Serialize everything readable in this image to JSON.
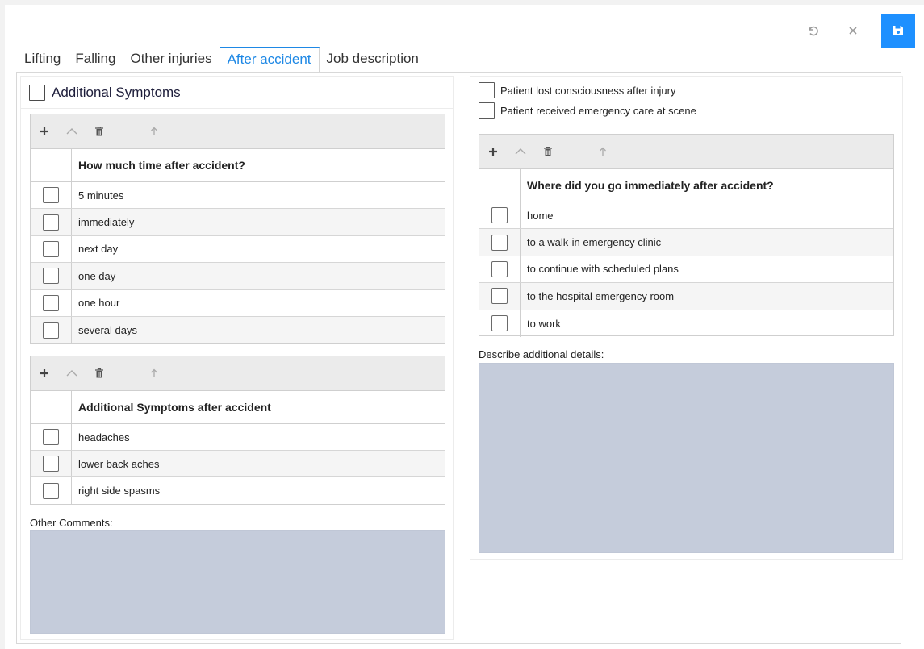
{
  "toolbar": {
    "undo_icon": "undo-icon",
    "close_icon": "close-icon",
    "save_icon": "save-icon",
    "save_color": "#1e90ff"
  },
  "tabs": [
    {
      "label": "Lifting",
      "active": false
    },
    {
      "label": "Falling",
      "active": false
    },
    {
      "label": "Other injuries",
      "active": false
    },
    {
      "label": "After accident",
      "active": true
    },
    {
      "label": "Job description",
      "active": false
    }
  ],
  "left": {
    "section_title": "Additional Symptoms",
    "time_grid": {
      "header": "How much time after accident?",
      "rows": [
        "5 minutes",
        "immediately",
        "next day",
        "one day",
        "one hour",
        "several days"
      ]
    },
    "symptoms_grid": {
      "header": "Additional Symptoms after accident",
      "rows": [
        "headaches",
        "lower back aches",
        "right side spasms"
      ]
    },
    "comments_label": "Other Comments:",
    "comments_value": ""
  },
  "right": {
    "check_lost_consciousness": "Patient lost consciousness after injury",
    "check_emergency_care": "Patient received emergency care at scene",
    "where_grid": {
      "header": "Where did you go immediately after accident?",
      "rows": [
        "home",
        "to a walk-in emergency clinic",
        "to continue with scheduled plans",
        "to the hospital emergency room",
        "to work"
      ]
    },
    "details_label": "Describe additional details:",
    "details_value": ""
  },
  "colors": {
    "accent": "#1e88e5",
    "textarea_bg": "#c5ccdb"
  }
}
